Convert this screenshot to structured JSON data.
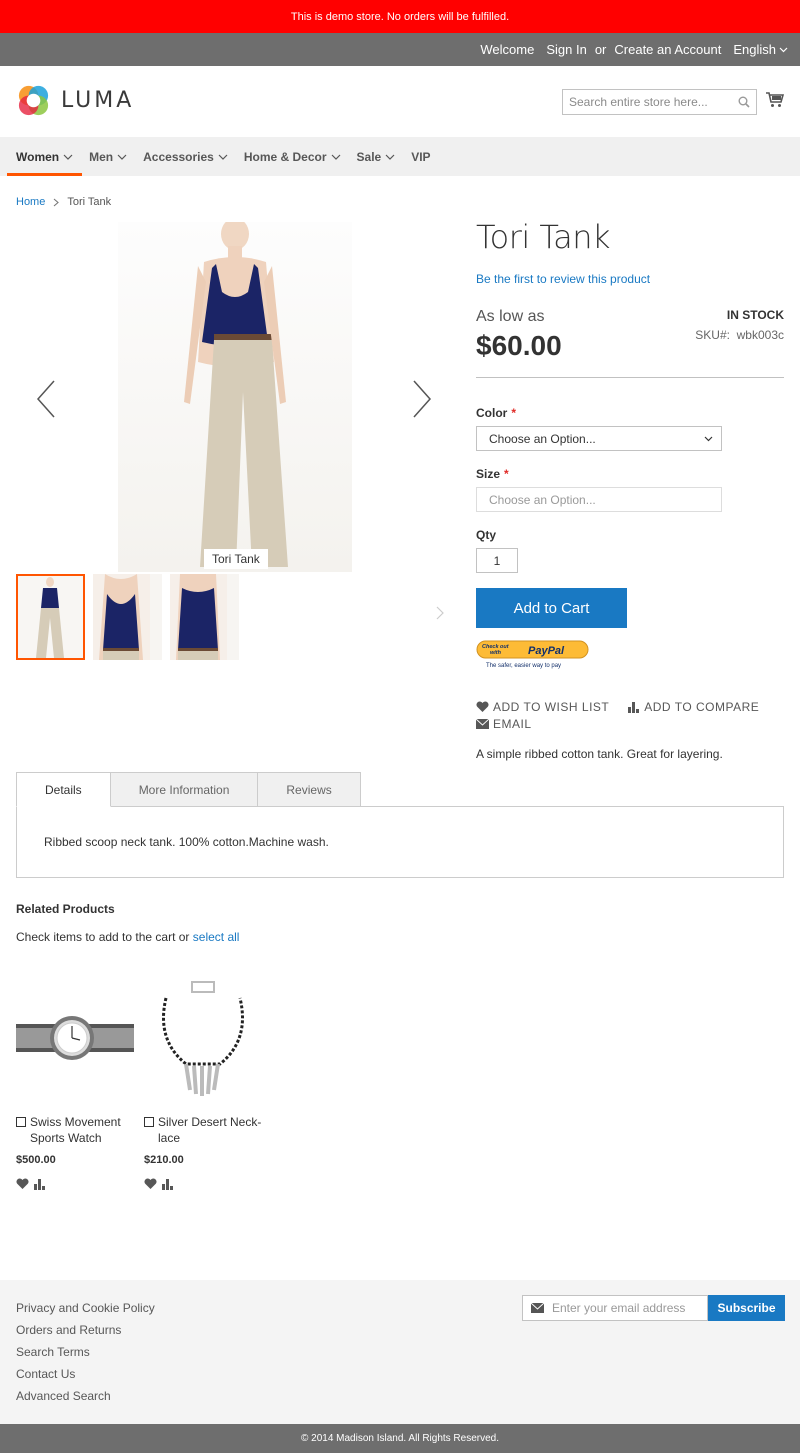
{
  "demo_notice": "This is demo store. No orders will be fulfilled.",
  "top_links": {
    "welcome": "Welcome",
    "sign_in": "Sign In",
    "or": "or",
    "create_account": "Create an Account",
    "language": "English"
  },
  "header": {
    "logo_text": "LUMA",
    "search_placeholder": "Search entire store here..."
  },
  "nav": {
    "items": [
      {
        "label": "Women"
      },
      {
        "label": "Men"
      },
      {
        "label": "Accessories"
      },
      {
        "label": "Home & Decor"
      },
      {
        "label": "Sale"
      },
      {
        "label": "VIP"
      }
    ]
  },
  "breadcrumb": {
    "home": "Home",
    "current": "Tori Tank"
  },
  "gallery": {
    "image_caption": "Tori Tank"
  },
  "product": {
    "title": "Tori Tank",
    "review_link": "Be the first to review this product",
    "as_low_as": "As low as",
    "price": "$60.00",
    "stock": "IN STOCK",
    "sku_label": "SKU#:",
    "sku_value": "wbk003c",
    "color_label": "Color",
    "color_placeholder": "Choose an Option...",
    "size_label": "Size",
    "size_placeholder": "Choose an Option...",
    "qty_label": "Qty",
    "qty_value": "1",
    "add_to_cart": "Add to Cart",
    "paypal_line1": "Check out",
    "paypal_line2": "with",
    "paypal_brand": "PayPal",
    "paypal_tagline": "The safer, easier way to pay",
    "wishlist": "ADD TO WISH LIST",
    "compare": "ADD TO COMPARE",
    "email": "EMAIL",
    "short_description": "A simple ribbed cotton tank. Great for layering."
  },
  "tabs": {
    "items": [
      {
        "label": "Details"
      },
      {
        "label": "More Information"
      },
      {
        "label": "Reviews"
      }
    ],
    "details_content": "Ribbed scoop neck tank. 100% cotton.Machine wash."
  },
  "related": {
    "title": "Related Products",
    "subtitle": "Check items to add to the cart or",
    "select_all": "select all",
    "products": [
      {
        "name_line1": "Swiss Movement",
        "name_line2": "Sports Watch",
        "price": "$500.00"
      },
      {
        "name_line1": "Silver Desert Neck-",
        "name_line2": "lace",
        "price": "$210.00"
      }
    ]
  },
  "footer": {
    "links": [
      "Privacy and Cookie Policy",
      "Orders and Returns",
      "Search Terms",
      "Contact Us",
      "Advanced Search"
    ],
    "newsletter_placeholder": "Enter your email address",
    "subscribe": "Subscribe",
    "copyright": "© 2014 Madison Island. All Rights Reserved."
  },
  "colors": {
    "demo_bar": "#ff0000",
    "accent_blue": "#1979c3",
    "nav_active": "#ff5501",
    "dark_bar": "#6e6e6e"
  }
}
